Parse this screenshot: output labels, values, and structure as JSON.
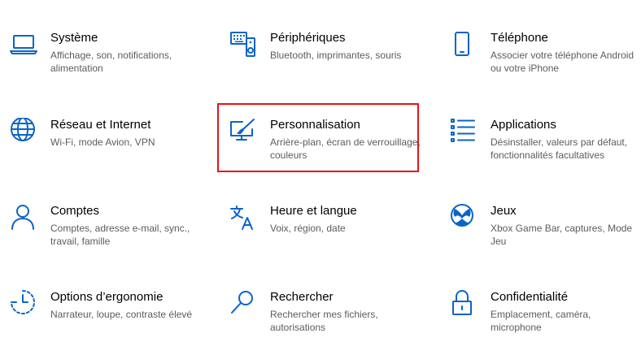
{
  "accent_color": "#0a64c8",
  "highlight_color": "#e8121a",
  "tiles": [
    {
      "title": "Système",
      "desc": "Affichage, son, notifications, alimentation",
      "icon": "laptop-icon"
    },
    {
      "title": "Périphériques",
      "desc": "Bluetooth, imprimantes, souris",
      "icon": "keyboard-speaker-icon"
    },
    {
      "title": "Téléphone",
      "desc": "Associer votre téléphone Android ou votre iPhone",
      "icon": "phone-icon"
    },
    {
      "title": "Réseau et Internet",
      "desc": "Wi-Fi, mode Avion, VPN",
      "icon": "globe-icon"
    },
    {
      "title": "Personnalisation",
      "desc": "Arrière-plan, écran de verrouillage, couleurs",
      "icon": "paintbrush-monitor-icon"
    },
    {
      "title": "Applications",
      "desc": "Désinstaller, valeurs par défaut, fonctionnalités facultatives",
      "icon": "app-list-icon"
    },
    {
      "title": "Comptes",
      "desc": "Comptes, adresse e-mail, sync., travail, famille",
      "icon": "person-icon"
    },
    {
      "title": "Heure et langue",
      "desc": "Voix, région, date",
      "icon": "language-icon"
    },
    {
      "title": "Jeux",
      "desc": "Xbox Game Bar, captures, Mode Jeu",
      "icon": "xbox-icon"
    },
    {
      "title": "Options d’ergonomie",
      "desc": "Narrateur, loupe, contraste élevé",
      "icon": "ease-of-access-icon"
    },
    {
      "title": "Rechercher",
      "desc": "Rechercher mes fichiers, autorisations",
      "icon": "search-icon"
    },
    {
      "title": "Confidentialité",
      "desc": "Emplacement, caméra, microphone",
      "icon": "lock-icon"
    }
  ]
}
